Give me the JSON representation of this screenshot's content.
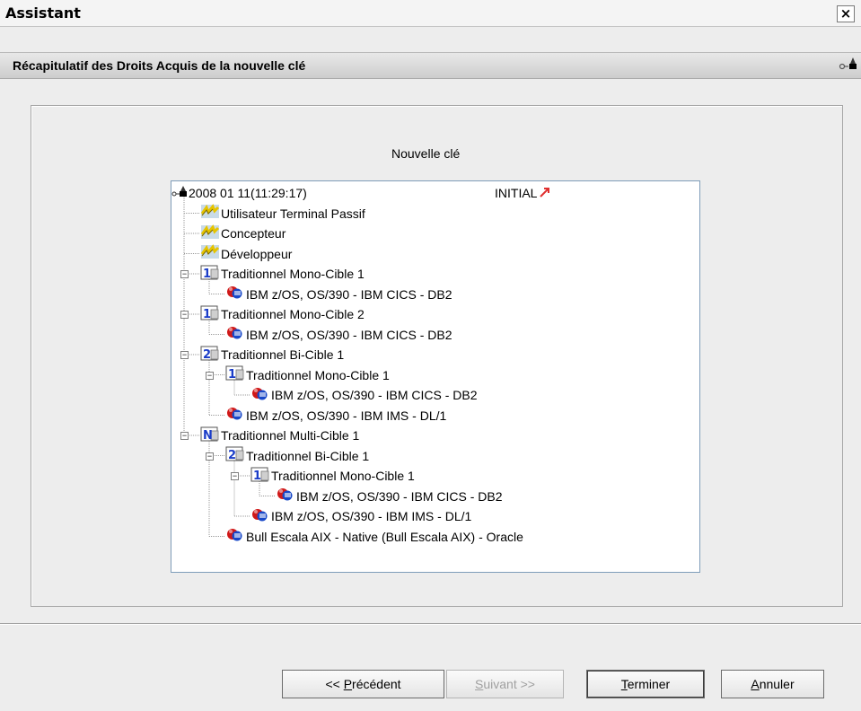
{
  "window": {
    "title": "Assistant",
    "close_label": "×"
  },
  "header": {
    "title": "Récapitulatif des Droits Acquis de la nouvelle clé",
    "icon": "key-lock-icon"
  },
  "panel": {
    "caption": "Nouvelle clé"
  },
  "tree": {
    "root": {
      "label": "2008 01 11(11:29:17)",
      "status": "INITIAL",
      "icon": "key-lock-icon"
    },
    "nodes": [
      {
        "label": "Utilisateur Terminal Passif",
        "icon": "role-icon"
      },
      {
        "label": "Concepteur",
        "icon": "role-icon"
      },
      {
        "label": "Développeur",
        "icon": "role-icon"
      },
      {
        "label": "Traditionnel Mono-Cible 1",
        "icon": "target-1-icon"
      },
      {
        "label": "IBM z/OS, OS/390 - IBM CICS - DB2",
        "icon": "platform-icon"
      },
      {
        "label": "Traditionnel Mono-Cible 2",
        "icon": "target-1-icon"
      },
      {
        "label": "IBM z/OS, OS/390 - IBM CICS - DB2",
        "icon": "platform-icon"
      },
      {
        "label": "Traditionnel Bi-Cible 1",
        "icon": "target-2-icon"
      },
      {
        "label": "Traditionnel Mono-Cible 1",
        "icon": "target-1-icon"
      },
      {
        "label": "IBM z/OS, OS/390 - IBM CICS - DB2",
        "icon": "platform-icon"
      },
      {
        "label": "IBM z/OS, OS/390 - IBM IMS - DL/1",
        "icon": "platform-icon"
      },
      {
        "label": "Traditionnel Multi-Cible 1",
        "icon": "target-n-icon"
      },
      {
        "label": "Traditionnel Bi-Cible 1",
        "icon": "target-2-icon"
      },
      {
        "label": "Traditionnel Mono-Cible 1",
        "icon": "target-1-icon"
      },
      {
        "label": "IBM z/OS, OS/390 - IBM CICS - DB2",
        "icon": "platform-icon"
      },
      {
        "label": "IBM z/OS, OS/390 - IBM IMS - DL/1",
        "icon": "platform-icon"
      },
      {
        "label": "Bull Escala AIX - Native (Bull Escala AIX) - Oracle",
        "icon": "platform-icon"
      }
    ]
  },
  "buttons": {
    "previous": {
      "prefix": "<< ",
      "mnemonic": "P",
      "rest": "récédent"
    },
    "next": {
      "mnemonic": "S",
      "rest": "uivant >>"
    },
    "finish": {
      "mnemonic": "T",
      "rest": "erminer"
    },
    "cancel": {
      "mnemonic": "A",
      "rest": "nnuler"
    }
  }
}
